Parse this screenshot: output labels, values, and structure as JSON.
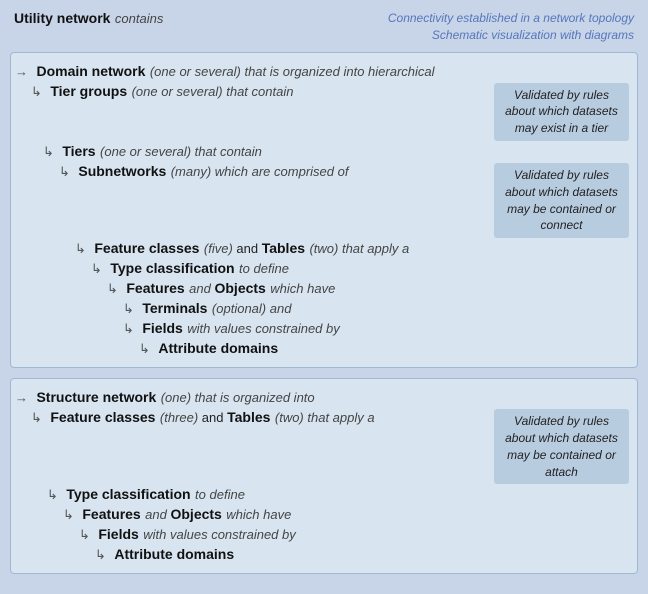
{
  "header": {
    "title": "Utility network",
    "title_italic": "contains",
    "connectivity_line1": "Connectivity established in a network topology",
    "connectivity_line2": "Schematic visualization with diagrams"
  },
  "domain_section": {
    "validated_tier": "Validated by rules about which datasets may exist in a tier",
    "validated_subnetwork": "Validated by rules about which datasets may be contained or connect",
    "rows": [
      {
        "indent": 0,
        "label": "Domain network",
        "italic": "(one or several) that is organized into hierarchical",
        "validated": ""
      },
      {
        "indent": 1,
        "label": "Tier groups",
        "italic": "(one or several) that contain",
        "validated": "Validated by rules about which datasets may exist in a tier"
      },
      {
        "indent": 2,
        "label": "Tiers",
        "italic": "(one or several) that contain",
        "validated": ""
      },
      {
        "indent": 3,
        "label": "Subnetworks",
        "italic": "(many) which are comprised of",
        "validated": "Validated by rules about which datasets may be contained or connect"
      },
      {
        "indent": 4,
        "label": "Feature classes",
        "italic_mid": "(five)",
        "and": " and ",
        "label2": "Tables",
        "italic_mid2": "(two)",
        "rest": " that apply a",
        "validated": ""
      },
      {
        "indent": 5,
        "label": "Type classification",
        "italic": "to define",
        "validated": ""
      },
      {
        "indent": 6,
        "label": "Features",
        "italic": "and",
        "label2": "Objects",
        "rest": " which have",
        "validated": ""
      },
      {
        "indent": 7,
        "label": "Terminals",
        "italic": "(optional) and",
        "validated": ""
      },
      {
        "indent": 7,
        "label": "Fields",
        "italic": "with values constrained by",
        "validated": ""
      },
      {
        "indent": 8,
        "label": "Attribute domains",
        "italic": "",
        "validated": ""
      }
    ]
  },
  "structure_section": {
    "validated": "Validated by rules about which datasets may be contained or attach",
    "rows": [
      {
        "indent": 0,
        "label": "Structure network",
        "italic": "(one) that is organized into",
        "validated": ""
      },
      {
        "indent": 1,
        "label": "Feature classes",
        "italic_mid": "(three)",
        "and": " and ",
        "label2": "Tables",
        "italic_mid2": "(two)",
        "rest": " that apply a",
        "validated": "Validated by rules about which datasets may be contained or attach"
      },
      {
        "indent": 2,
        "label": "Type classification",
        "italic": "to define",
        "validated": ""
      },
      {
        "indent": 3,
        "label": "Features",
        "italic": "and",
        "label2": "Objects",
        "rest": " which have",
        "validated": ""
      },
      {
        "indent": 4,
        "label": "Fields",
        "italic": "with values constrained by",
        "validated": ""
      },
      {
        "indent": 5,
        "label": "Attribute domains",
        "italic": "",
        "validated": ""
      }
    ]
  }
}
